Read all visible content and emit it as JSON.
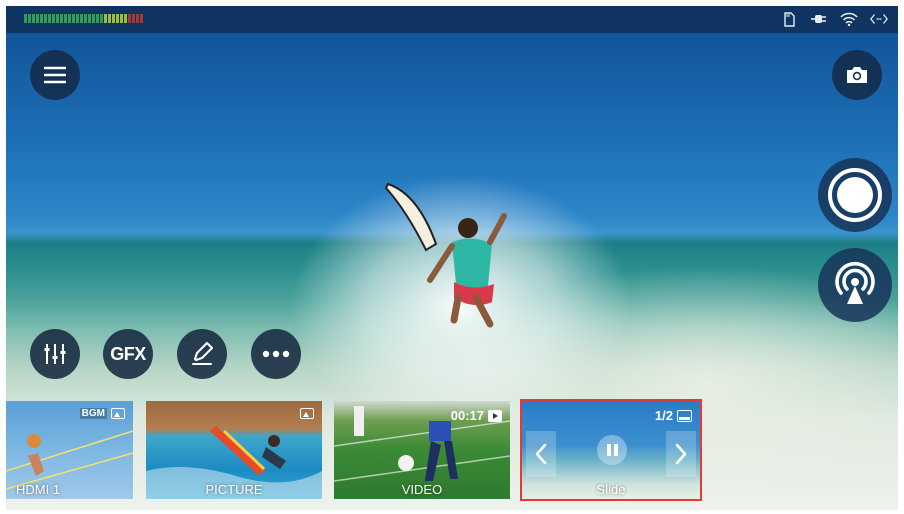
{
  "status_bar": {
    "audio_meter_colors": [
      "#2e9e4f",
      "#2e9e4f",
      "#2e9e4f",
      "#2e9e4f",
      "#2e9e4f",
      "#2e9e4f",
      "#2e9e4f",
      "#2e9e4f",
      "#2e9e4f",
      "#2e9e4f",
      "#2e9e4f",
      "#2e9e4f",
      "#2e9e4f",
      "#2e9e4f",
      "#2e9e4f",
      "#2e9e4f",
      "#2e9e4f",
      "#2e9e4f",
      "#2e9e4f",
      "#2e9e4f",
      "#9fbe3a",
      "#9fbe3a",
      "#9fbe3a",
      "#9fbe3a",
      "#9fbe3a",
      "#9fbe3a",
      "#a33a3a",
      "#a33a3a",
      "#a33a3a",
      "#a33a3a"
    ],
    "icons": [
      "sd-card-icon",
      "power-plug-icon",
      "wifi-icon",
      "network-icon"
    ]
  },
  "controls": {
    "menu_icon": "hamburger-menu-icon",
    "snapshot_icon": "camera-icon",
    "record_icon": "record-icon",
    "live_icon": "live-stream-icon",
    "mixer_icon": "audio-mixer-icon",
    "gfx_label": "GFX",
    "draw_icon": "pen-icon",
    "more_icon": "more-dots-icon"
  },
  "sources": {
    "hdmi": {
      "label": "HDMI 1",
      "badge": "BGM"
    },
    "picture": {
      "label": "PICTURE"
    },
    "video": {
      "label": "VIDEO",
      "duration": "00:17"
    },
    "slide": {
      "label": "Slide",
      "page": "1/2",
      "selected_color": "#e53935"
    }
  }
}
